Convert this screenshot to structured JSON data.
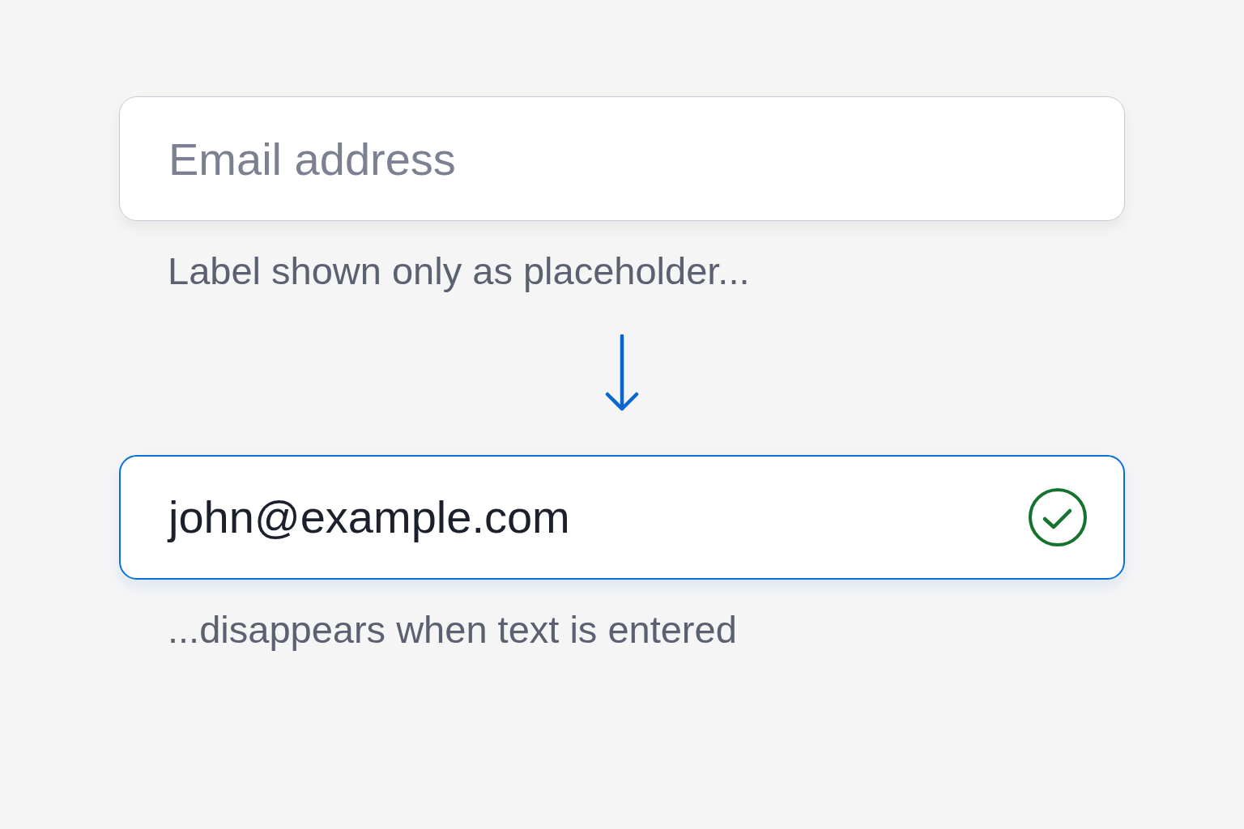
{
  "fields": [
    {
      "placeholder": "Email address",
      "focused": false,
      "valid": false,
      "caption": "Label shown only as placeholder..."
    },
    {
      "value": "john@example.com",
      "focused": true,
      "valid": true,
      "caption": "...disappears when text is entered"
    }
  ]
}
